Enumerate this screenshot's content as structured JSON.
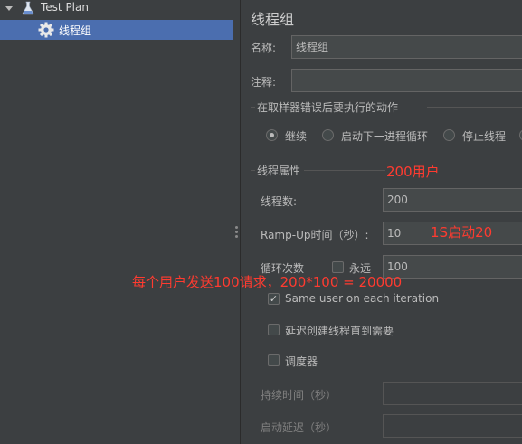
{
  "tree": {
    "items": [
      {
        "label": "Test Plan",
        "icon": "flask-icon"
      },
      {
        "label": "线程组",
        "icon": "gear-icon",
        "selected": true
      }
    ]
  },
  "panel": {
    "title": "线程组",
    "name_label": "名称:",
    "name_value": "线程组",
    "comment_label": "注释:",
    "comment_value": "",
    "sampler_error": {
      "title": "在取样器错误后要执行的动作",
      "options": [
        "继续",
        "启动下一进程循环",
        "停止线程"
      ],
      "selected": "继续"
    },
    "thread_props": {
      "title": "线程属性",
      "threads_label": "线程数:",
      "threads_value": "200",
      "rampup_label": "Ramp-Up时间（秒）:",
      "rampup_value": "10",
      "loop_label": "循环次数",
      "forever_label": "永远",
      "forever_checked": false,
      "loop_value": "100",
      "same_user_label": "Same user on each iteration",
      "same_user_checked": true,
      "delay_label": "延迟创建线程直到需要",
      "delay_checked": false,
      "scheduler_label": "调度器",
      "scheduler_checked": false,
      "duration_label": "持续时间（秒）",
      "duration_value": "",
      "startup_delay_label": "启动延迟（秒）",
      "startup_delay_value": ""
    }
  },
  "annotations": {
    "users": "200用户",
    "rampup": "1S启动20",
    "requests": "每个用户发送100请求，200*100 = 20000"
  },
  "colors": {
    "background": "#3c3f41",
    "selection": "#4b6eaf",
    "annotation": "#ff3b30"
  }
}
